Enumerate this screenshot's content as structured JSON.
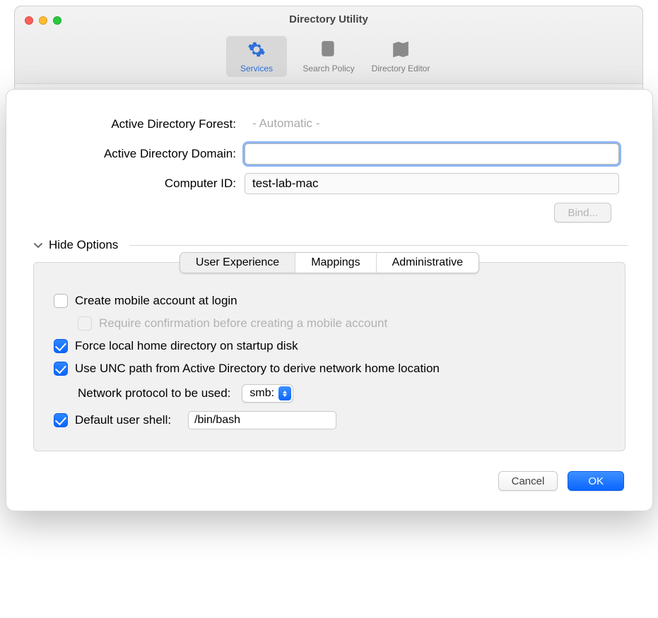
{
  "window": {
    "title": "Directory Utility"
  },
  "toolbar": {
    "items": [
      {
        "label": "Services",
        "icon": "gear-icon",
        "active": true
      },
      {
        "label": "Search Policy",
        "icon": "search-icon",
        "active": false
      },
      {
        "label": "Directory Editor",
        "icon": "map-icon",
        "active": false
      }
    ]
  },
  "sheet": {
    "fields": {
      "forest_label": "Active Directory Forest:",
      "forest_value": "- Automatic -",
      "domain_label": "Active Directory Domain:",
      "domain_value": "",
      "computer_label": "Computer ID:",
      "computer_value": "test-lab-mac"
    },
    "bind_button": "Bind...",
    "disclosure_label": "Hide Options",
    "tabs": {
      "user_experience": "User Experience",
      "mappings": "Mappings",
      "administrative": "Administrative"
    },
    "options": {
      "create_mobile": "Create mobile account at login",
      "require_confirm": "Require confirmation before creating a mobile account",
      "force_local_home": "Force local home directory on startup disk",
      "use_unc": "Use UNC path from Active Directory to derive network home location",
      "protocol_label": "Network protocol to be used:",
      "protocol_value": "smb:",
      "default_shell_label": "Default user shell:",
      "default_shell_value": "/bin/bash"
    },
    "footer": {
      "cancel": "Cancel",
      "ok": "OK"
    }
  }
}
